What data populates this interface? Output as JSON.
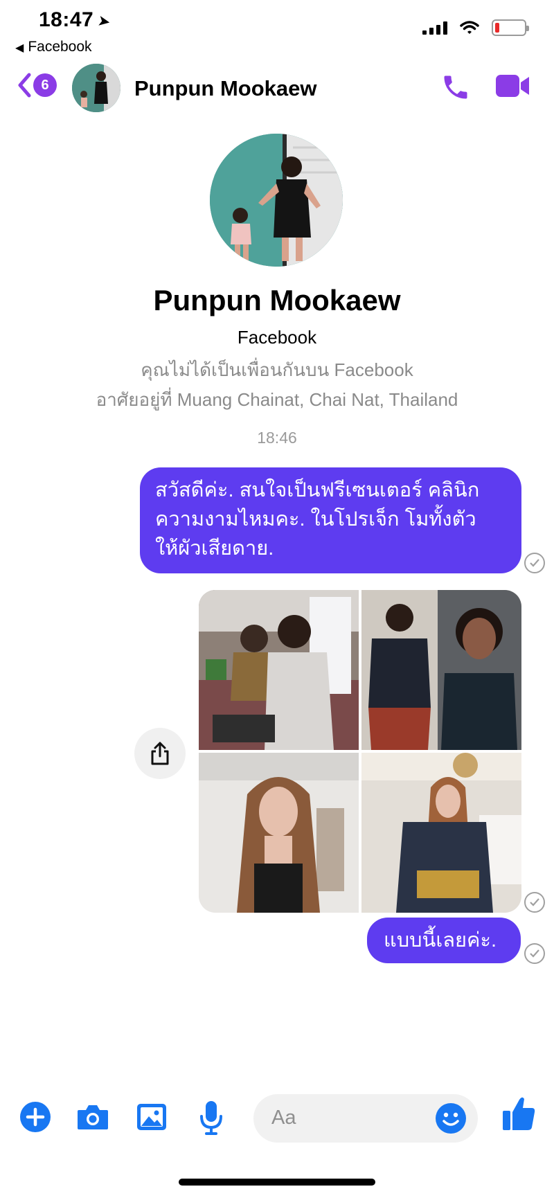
{
  "status_bar": {
    "time": "18:47",
    "back_app": "Facebook"
  },
  "header": {
    "unread_count": "6",
    "contact_name": "Punpun Mookaew"
  },
  "profile": {
    "name": "Punpun Mookaew",
    "platform": "Facebook",
    "friend_status": "คุณไม่ได้เป็นเพื่อนกันบน Facebook",
    "location": "อาศัยอยู่ที่ Muang Chainat, Chai Nat, Thailand"
  },
  "messages": {
    "timestamp": "18:46",
    "first_line_1": "สวัสดีค่ะ. สนใจเป็นฟรีเซนเตอร์ คลินิก",
    "first_line_2": "ความงามไหมคะ.  ในโปรเจ็ก โมทั้งตัว",
    "first_line_3": "ให้ผัวเสียดาย.",
    "second": "แบบนี้เลยค่ะ."
  },
  "composer": {
    "placeholder": "Aa"
  },
  "colors": {
    "accent": "#8b3ce6",
    "bubble": "#5e3cf0",
    "composer_icons": "#1877f2"
  },
  "icons": [
    "back-chevron-icon",
    "phone-icon",
    "video-camera-icon",
    "share-icon",
    "plus-icon",
    "camera-icon",
    "gallery-icon",
    "microphone-icon",
    "emoji-icon",
    "thumbs-up-icon"
  ]
}
